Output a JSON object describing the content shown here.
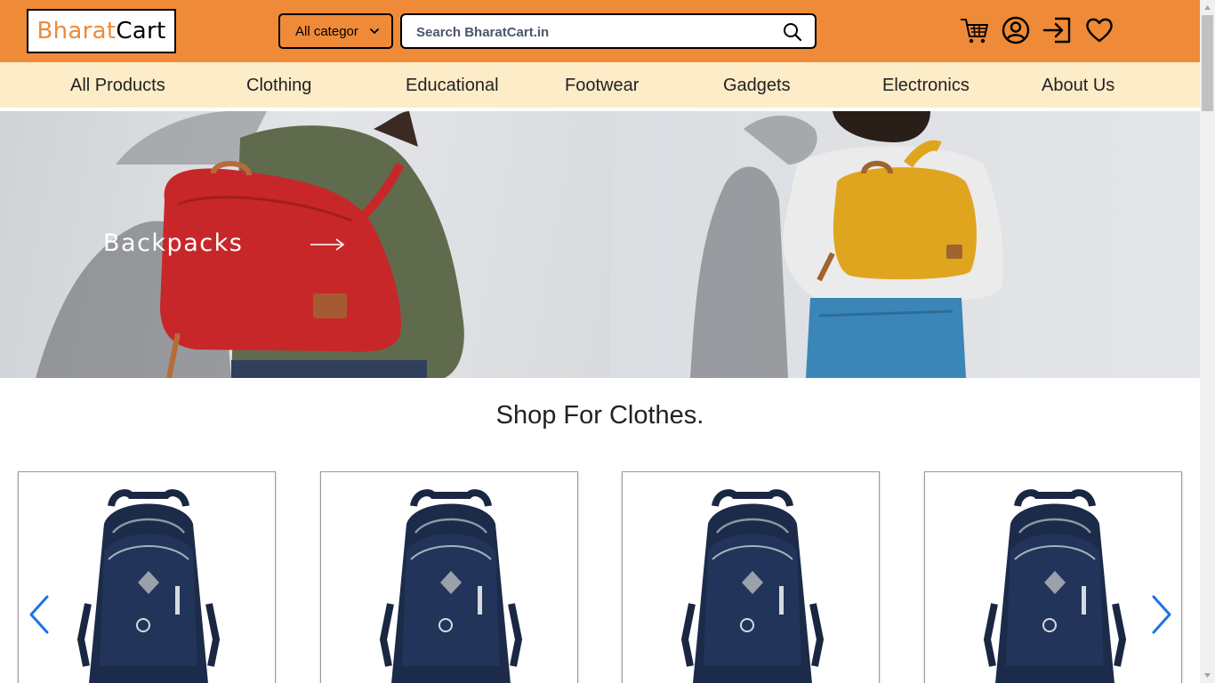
{
  "header": {
    "logo_part1": "Bharat",
    "logo_part2": "Cart",
    "category_select": "All categor",
    "search_placeholder": "Search BharatCart.in",
    "icons": [
      "cart-icon",
      "user-icon",
      "login-icon",
      "heart-icon"
    ],
    "background_color": "#ee8a38"
  },
  "nav": {
    "items": [
      "All Products",
      "Clothing",
      "Educational",
      "Footwear",
      "Gadgets",
      "Electronics",
      "About Us"
    ],
    "background_color": "#fdecc8"
  },
  "banner": {
    "label": "Backpacks"
  },
  "section": {
    "title": "Shop For Clothes."
  },
  "carousel": {
    "prev_icon": "chevron-left-icon",
    "next_icon": "chevron-right-icon",
    "accent_color": "#1a73e8"
  }
}
